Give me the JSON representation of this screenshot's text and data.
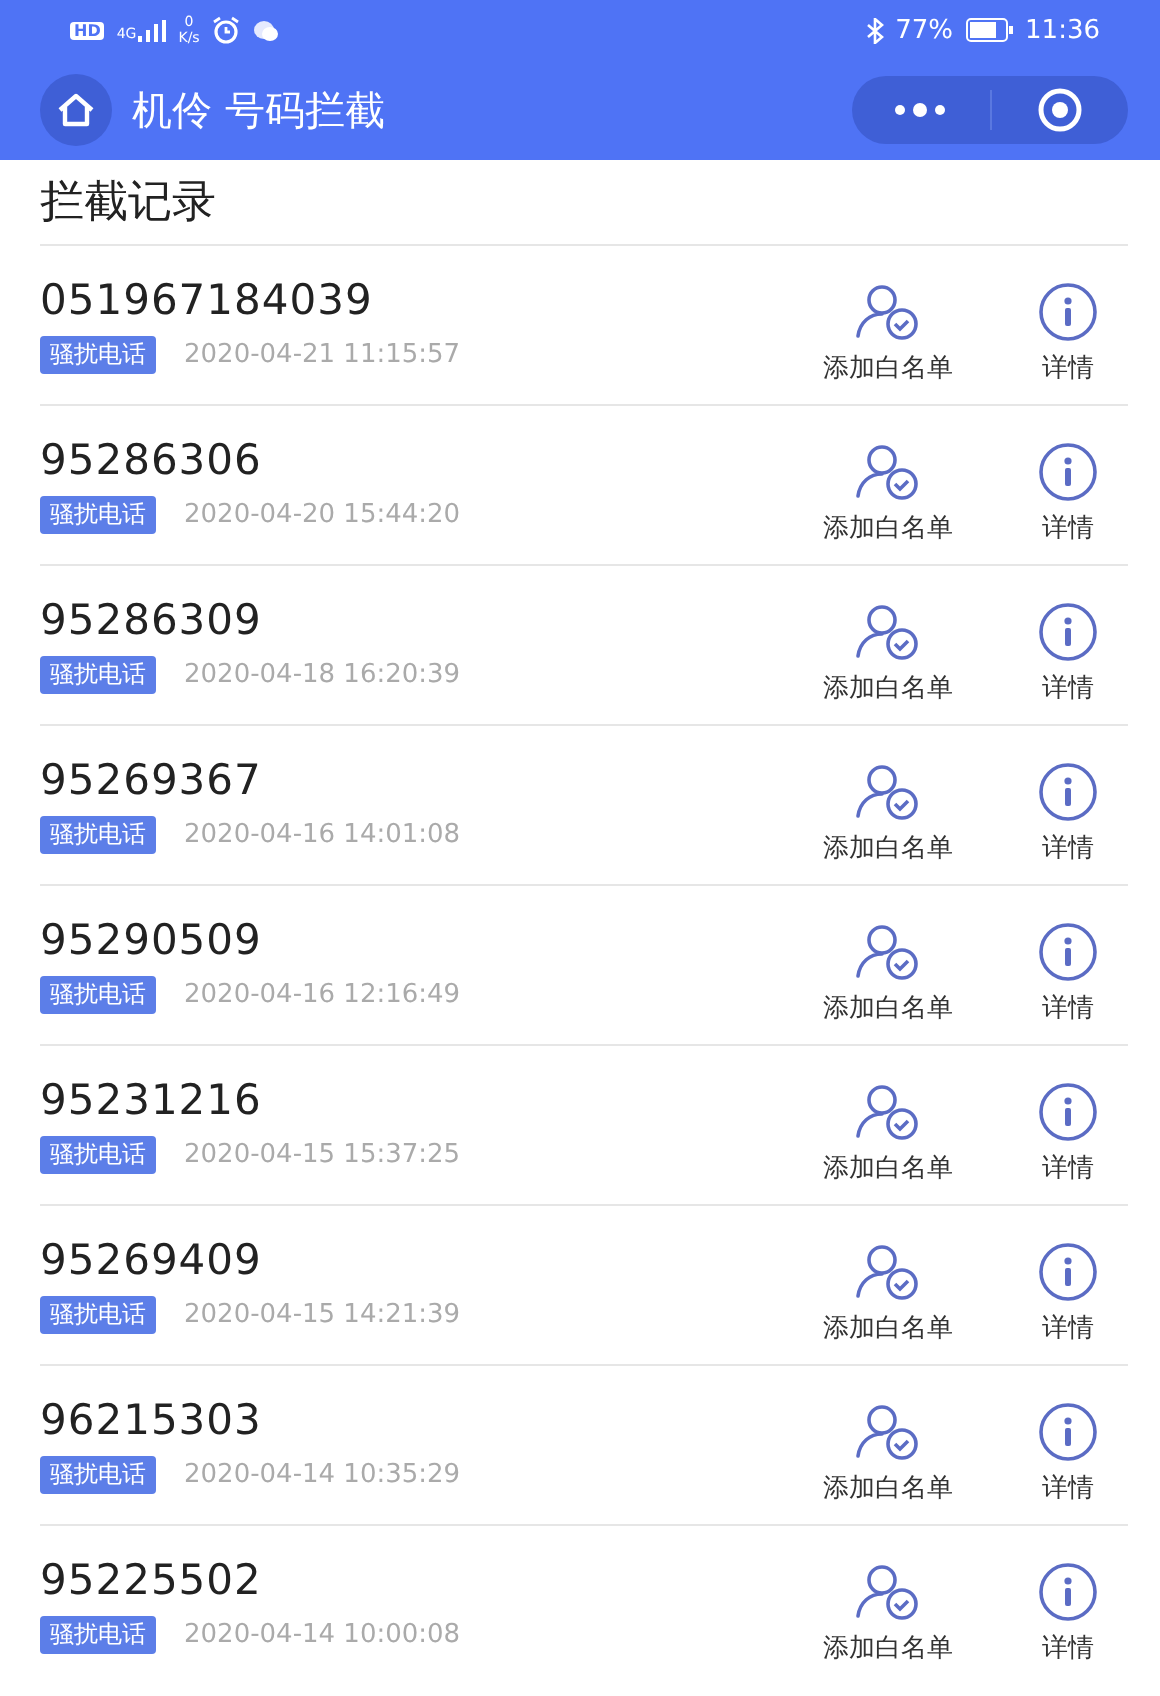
{
  "status_bar": {
    "hd": "HD",
    "network": "4G",
    "speed": "0",
    "speed_unit": "K/s",
    "battery_percent": "77%",
    "time": "11:36"
  },
  "nav": {
    "title": "机伶 号码拦截"
  },
  "section_title": "拦截记录",
  "records": [
    {
      "number": "051967184039",
      "tag": "骚扰电话",
      "time": "2020-04-21 11:15:57",
      "whitelist": "添加白名单",
      "details": "详情"
    },
    {
      "number": "95286306",
      "tag": "骚扰电话",
      "time": "2020-04-20 15:44:20",
      "whitelist": "添加白名单",
      "details": "详情"
    },
    {
      "number": "95286309",
      "tag": "骚扰电话",
      "time": "2020-04-18 16:20:39",
      "whitelist": "添加白名单",
      "details": "详情"
    },
    {
      "number": "95269367",
      "tag": "骚扰电话",
      "time": "2020-04-16 14:01:08",
      "whitelist": "添加白名单",
      "details": "详情"
    },
    {
      "number": "95290509",
      "tag": "骚扰电话",
      "time": "2020-04-16 12:16:49",
      "whitelist": "添加白名单",
      "details": "详情"
    },
    {
      "number": "95231216",
      "tag": "骚扰电话",
      "time": "2020-04-15 15:37:25",
      "whitelist": "添加白名单",
      "details": "详情"
    },
    {
      "number": "95269409",
      "tag": "骚扰电话",
      "time": "2020-04-15 14:21:39",
      "whitelist": "添加白名单",
      "details": "详情"
    },
    {
      "number": "96215303",
      "tag": "骚扰电话",
      "time": "2020-04-14 10:35:29",
      "whitelist": "添加白名单",
      "details": "详情"
    },
    {
      "number": "95225502",
      "tag": "骚扰电话",
      "time": "2020-04-14 10:00:08",
      "whitelist": "添加白名单",
      "details": "详情"
    }
  ]
}
